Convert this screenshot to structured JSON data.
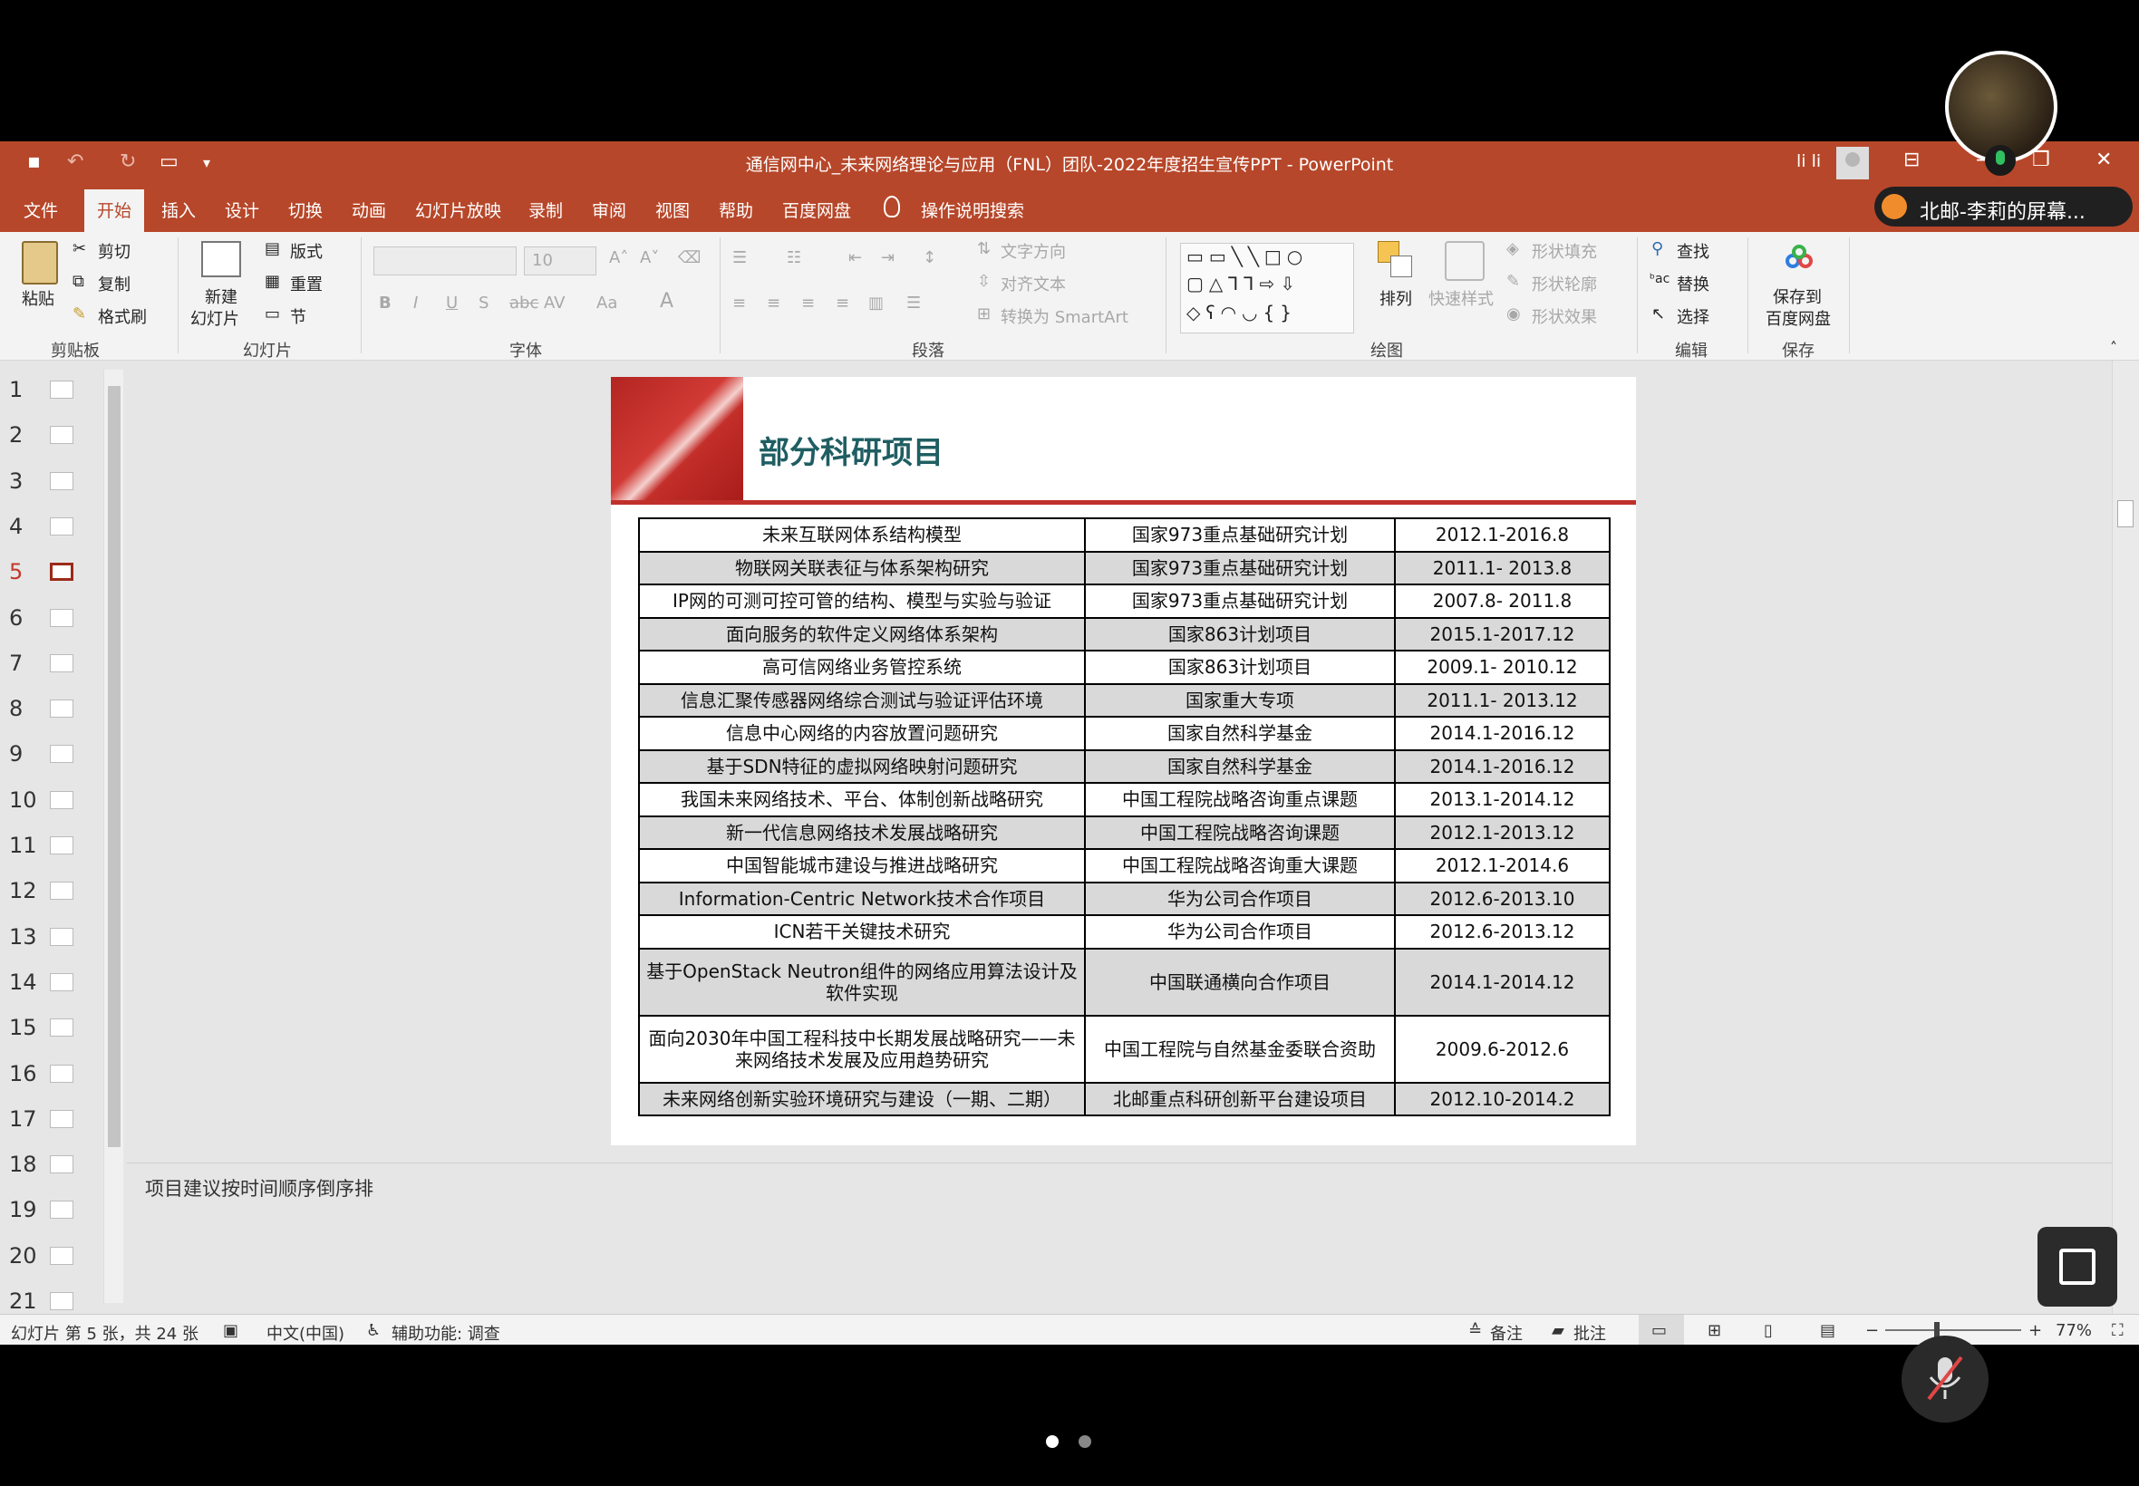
{
  "window": {
    "title": "通信网中心_未来网络理论与应用（FNL）团队-2022年度招生宣传PPT  -  PowerPoint",
    "user": "li li"
  },
  "tabs": [
    "文件",
    "开始",
    "插入",
    "设计",
    "切换",
    "动画",
    "幻灯片放映",
    "录制",
    "审阅",
    "视图",
    "帮助",
    "百度网盘"
  ],
  "active_tab": "开始",
  "tell_me": "操作说明搜索",
  "ribbon": {
    "clipboard": {
      "paste": "粘贴",
      "cut": "剪切",
      "copy": "复制",
      "format_painter": "格式刷",
      "label": "剪贴板"
    },
    "slides": {
      "new_slide": "新建",
      "new_slide2": "幻灯片",
      "layout": "版式",
      "reset": "重置",
      "section": "节",
      "label": "幻灯片"
    },
    "font": {
      "size": "10",
      "label": "字体",
      "bold": "B",
      "italic": "I",
      "underline": "U",
      "strike": "S",
      "spacing": "AV",
      "case": "Aa",
      "color": "A"
    },
    "paragraph": {
      "text_direction": "文字方向",
      "align_text": "对齐文本",
      "smartart": "转换为 SmartArt",
      "label": "段落"
    },
    "drawing": {
      "arrange": "排列",
      "quick_styles": "快速样式",
      "shape_fill": "形状填充",
      "shape_outline": "形状轮廓",
      "shape_effects": "形状效果",
      "label": "绘图"
    },
    "editing": {
      "find": "查找",
      "replace": "替换",
      "select": "选择",
      "label": "编辑"
    },
    "save": {
      "save_to": "保存到",
      "baidu": "百度网盘",
      "label": "保存"
    }
  },
  "thumbnails": {
    "numbers": [
      "1",
      "2",
      "3",
      "4",
      "5",
      "6",
      "7",
      "8",
      "9",
      "10",
      "11",
      "12",
      "13",
      "14",
      "15",
      "16",
      "17",
      "18",
      "19",
      "20",
      "21"
    ],
    "active": 5
  },
  "slide": {
    "title": "部分科研项目",
    "table": [
      [
        "未来互联网体系结构模型",
        "国家973重点基础研究计划",
        "2012.1-2016.8"
      ],
      [
        "物联网关联表征与体系架构研究",
        "国家973重点基础研究计划",
        "2011.1- 2013.8"
      ],
      [
        "IP网的可测可控可管的结构、模型与实验与验证",
        "国家973重点基础研究计划",
        "2007.8- 2011.8"
      ],
      [
        "面向服务的软件定义网络体系架构",
        "国家863计划项目",
        "2015.1-2017.12"
      ],
      [
        "高可信网络业务管控系统",
        "国家863计划项目",
        "2009.1- 2010.12"
      ],
      [
        "信息汇聚传感器网络综合测试与验证评估环境",
        "国家重大专项",
        "2011.1- 2013.12"
      ],
      [
        "信息中心网络的内容放置问题研究",
        "国家自然科学基金",
        "2014.1-2016.12"
      ],
      [
        "基于SDN特征的虚拟网络映射问题研究",
        "国家自然科学基金",
        "2014.1-2016.12"
      ],
      [
        "我国未来网络技术、平台、体制创新战略研究",
        "中国工程院战略咨询重点课题",
        "2013.1-2014.12"
      ],
      [
        "新一代信息网络技术发展战略研究",
        "中国工程院战略咨询课题",
        "2012.1-2013.12"
      ],
      [
        "中国智能城市建设与推进战略研究",
        "中国工程院战略咨询重大课题",
        "2012.1-2014.6"
      ],
      [
        "Information-Centric Network技术合作项目",
        "华为公司合作项目",
        "2012.6-2013.10"
      ],
      [
        "ICN若干关键技术研究",
        "华为公司合作项目",
        "2012.6-2013.12"
      ],
      [
        "基于OpenStack Neutron组件的网络应用算法设计及软件实现",
        "中国联通横向合作项目",
        "2014.1-2014.12"
      ],
      [
        "面向2030年中国工程科技中长期发展战略研究——未来网络技术发展及应用趋势研究",
        "中国工程院与自然基金委联合资助",
        "2009.6-2012.6"
      ],
      [
        "未来网络创新实验环境研究与建设（一期、二期）",
        "北邮重点科研创新平台建设项目",
        "2012.10-2014.2"
      ]
    ]
  },
  "notes": "项目建议按时间顺序倒序排",
  "status": {
    "slide_info": "幻灯片 第 5 张，共 24 张",
    "language": "中文(中国)",
    "accessibility": "辅助功能: 调查",
    "notes_btn": "备注",
    "comments_btn": "批注",
    "zoom": "77%"
  },
  "presenter": "北邮-李莉的屏幕..."
}
